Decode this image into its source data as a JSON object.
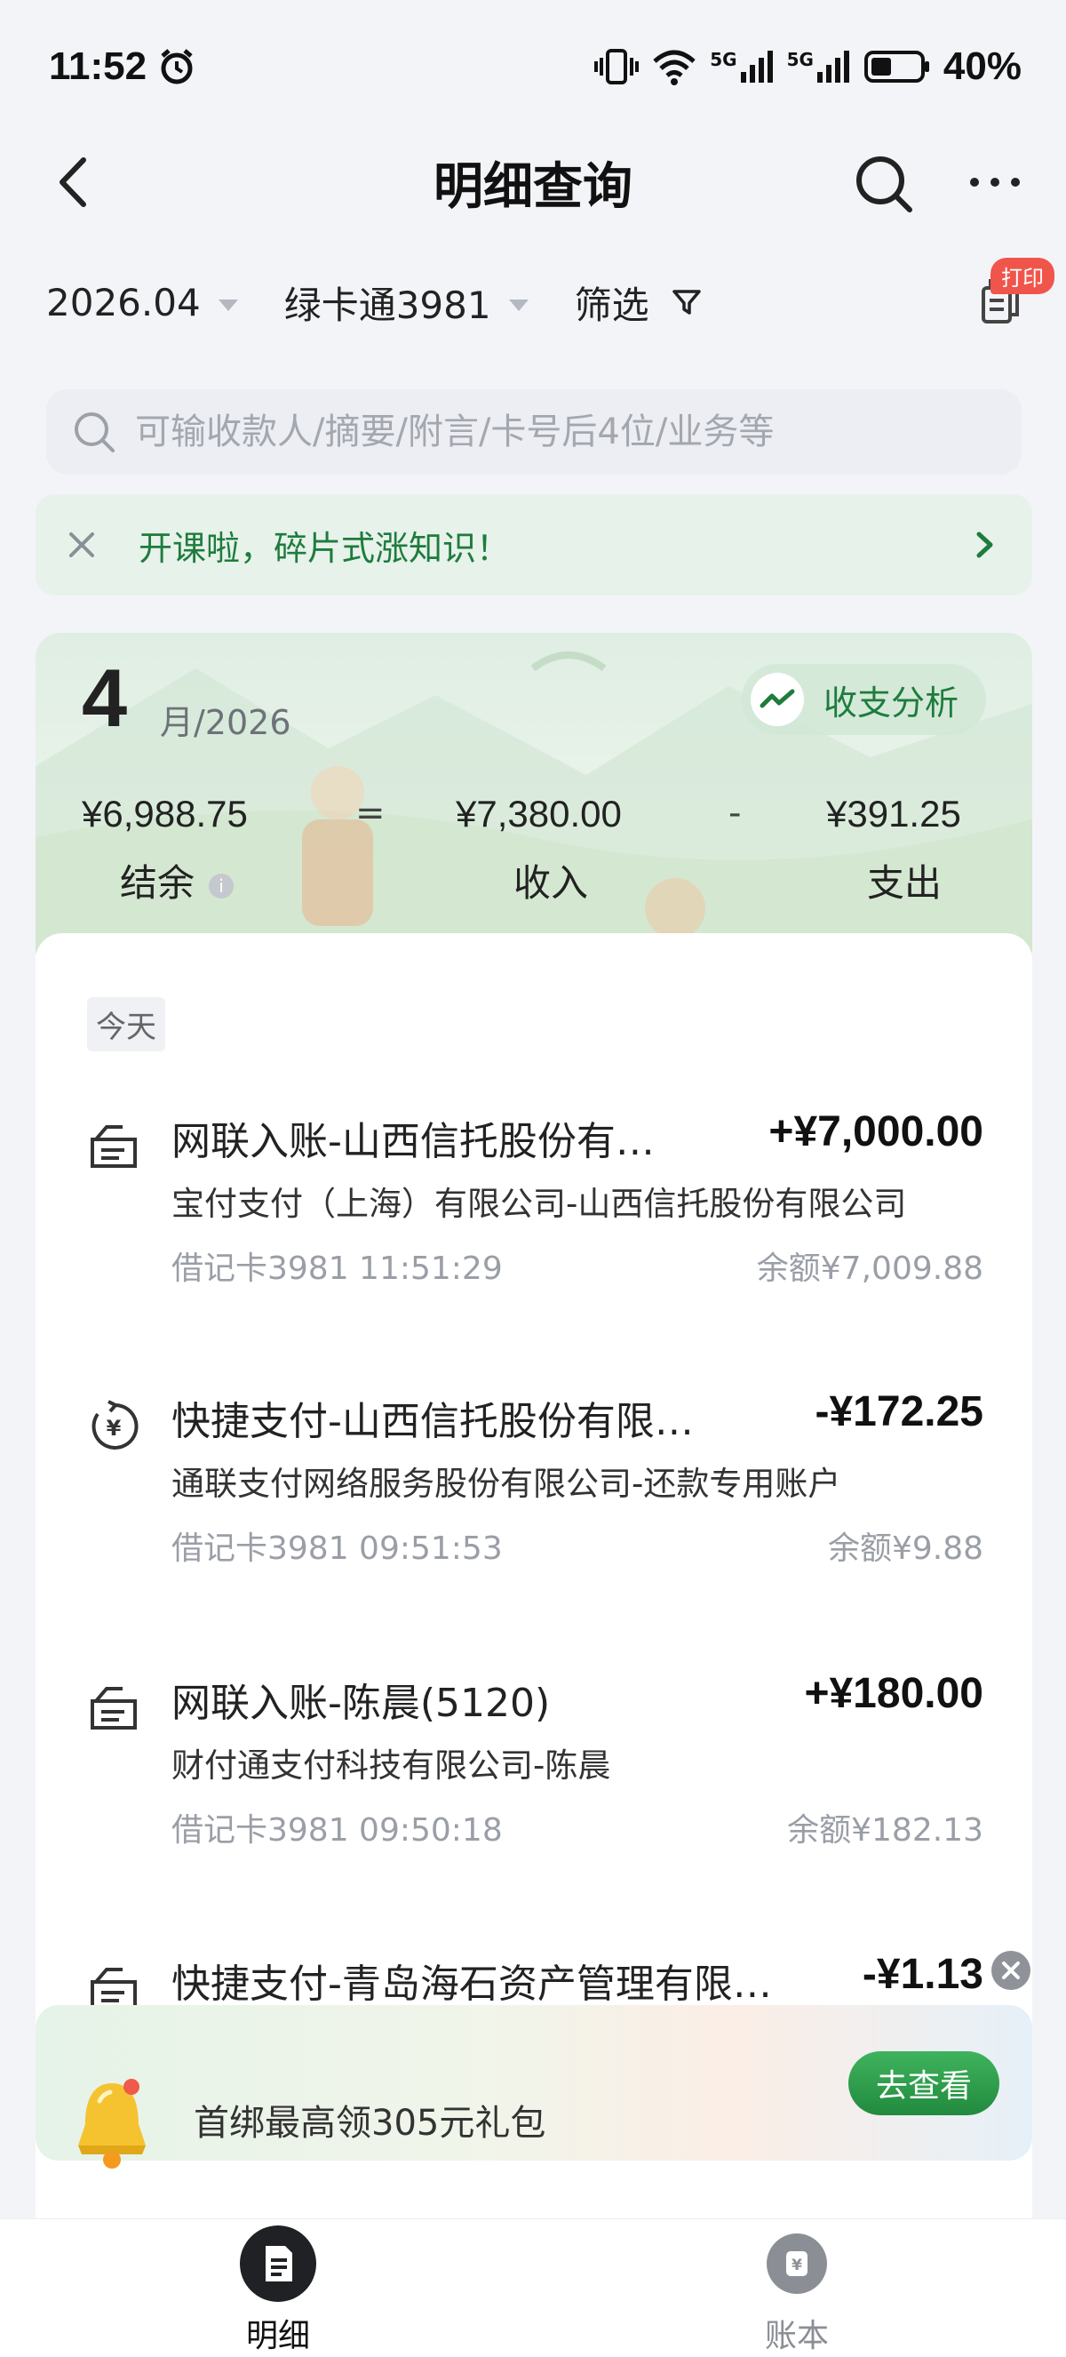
{
  "status_bar": {
    "time": "11:52",
    "battery": "40%",
    "network1": "5G",
    "network2": "5G"
  },
  "nav": {
    "title": "明细查询"
  },
  "filters": {
    "month": "2026.04",
    "card": "绿卡通3981",
    "filter_label": "筛选",
    "print_badge": "打印"
  },
  "search": {
    "placeholder": "可输收款人/摘要/附言/卡号后4位/业务等"
  },
  "promo": {
    "text": "开课啦，碎片式涨知识！"
  },
  "summary": {
    "month": "4",
    "year_suffix": "月/2026",
    "analysis_label": "收支分析",
    "balance_value": "¥6,988.75",
    "balance_label": "结余",
    "eq": "=",
    "income_value": "¥7,380.00",
    "income_label": "收入",
    "minus": "-",
    "expense_value": "¥391.25",
    "expense_label": "支出"
  },
  "list": {
    "today_label": "今天",
    "transactions": [
      {
        "icon": "transfer-in-icon",
        "name": "网联入账-山西信托股份有…",
        "amount": "+¥7,000.00",
        "desc": "宝付支付（上海）有限公司-山西信托股份有限公司",
        "meta": "借记卡3981 11:51:29",
        "balance": "余额¥7,009.88"
      },
      {
        "icon": "quick-pay-icon",
        "name": "快捷支付-山西信托股份有限…",
        "amount": "-¥172.25",
        "desc": "通联支付网络服务股份有限公司-还款专用账户",
        "meta": "借记卡3981 09:51:53",
        "balance": "余额¥9.88"
      },
      {
        "icon": "transfer-in-icon",
        "name": "网联入账-陈晨(5120)",
        "amount": "+¥180.00",
        "desc": "财付通支付科技有限公司-陈晨",
        "meta": "借记卡3981 09:50:18",
        "balance": "余额¥182.13"
      },
      {
        "icon": "transfer-in-icon",
        "name": "快捷支付-青岛海石资产管理有限…",
        "amount": "-¥1.13",
        "desc": "",
        "meta": "",
        "balance": ""
      }
    ]
  },
  "ad": {
    "text": "首绑最高领305元礼包",
    "button": "去查看"
  },
  "tabs": [
    {
      "label": "明细",
      "active": true
    },
    {
      "label": "账本",
      "active": false
    }
  ],
  "colors": {
    "brand_green": "#1e7c3d",
    "badge_red": "#f0554b"
  }
}
